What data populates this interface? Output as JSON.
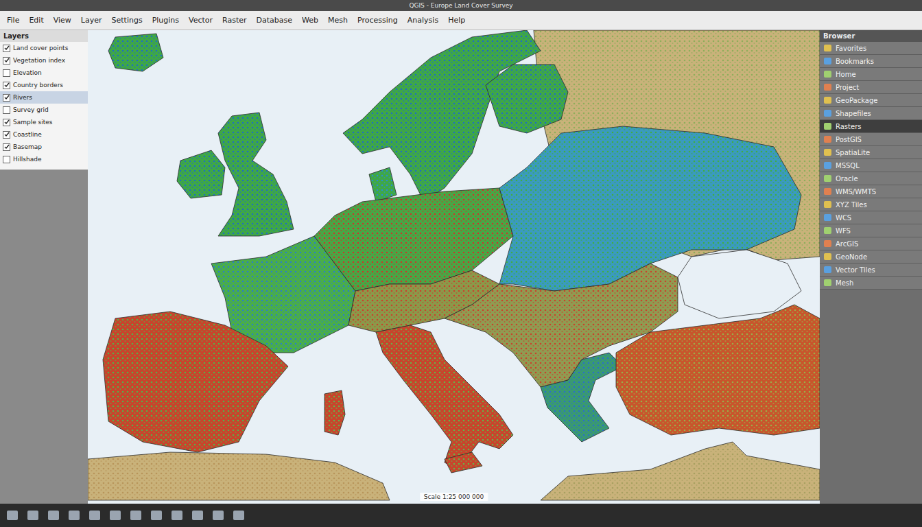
{
  "window": {
    "title": "QGIS - Europe Land Cover Survey"
  },
  "menu": [
    "File",
    "Edit",
    "View",
    "Layer",
    "Settings",
    "Plugins",
    "Vector",
    "Raster",
    "Database",
    "Web",
    "Mesh",
    "Processing",
    "Analysis",
    "Help"
  ],
  "layers": {
    "title": "Layers",
    "items": [
      {
        "label": "Land cover points",
        "checked": true,
        "selected": false
      },
      {
        "label": "Vegetation index",
        "checked": true,
        "selected": false
      },
      {
        "label": "Elevation",
        "checked": false,
        "selected": false
      },
      {
        "label": "Country borders",
        "checked": true,
        "selected": false
      },
      {
        "label": "Rivers",
        "checked": true,
        "selected": true
      },
      {
        "label": "Survey grid",
        "checked": false,
        "selected": false
      },
      {
        "label": "Sample sites",
        "checked": true,
        "selected": false
      },
      {
        "label": "Coastline",
        "checked": true,
        "selected": false
      },
      {
        "label": "Basemap",
        "checked": true,
        "selected": false
      },
      {
        "label": "Hillshade",
        "checked": false,
        "selected": false
      }
    ]
  },
  "browser": {
    "title": "Browser",
    "items": [
      {
        "label": "Favorites",
        "selected": false
      },
      {
        "label": "Bookmarks",
        "selected": false
      },
      {
        "label": "Home",
        "selected": false
      },
      {
        "label": "Project",
        "selected": false
      },
      {
        "label": "GeoPackage",
        "selected": false
      },
      {
        "label": "Shapefiles",
        "selected": false
      },
      {
        "label": "Rasters",
        "selected": true
      },
      {
        "label": "PostGIS",
        "selected": false
      },
      {
        "label": "SpatiaLite",
        "selected": false
      },
      {
        "label": "MSSQL",
        "selected": false
      },
      {
        "label": "Oracle",
        "selected": false
      },
      {
        "label": "WMS/WMTS",
        "selected": false
      },
      {
        "label": "XYZ Tiles",
        "selected": false
      },
      {
        "label": "WCS",
        "selected": false
      },
      {
        "label": "WFS",
        "selected": false
      },
      {
        "label": "ArcGIS",
        "selected": false
      },
      {
        "label": "GeoNode",
        "selected": false
      },
      {
        "label": "Vector Tiles",
        "selected": false
      },
      {
        "label": "Mesh",
        "selected": false
      }
    ]
  },
  "map": {
    "status": "Scale 1:25 000 000",
    "regions": [
      {
        "color": "#c9b27a",
        "accent": "#8fae5a"
      },
      {
        "color": "#c9b27a",
        "accent": "#b8955a"
      },
      {
        "color": "#c9b27a",
        "accent": "#a8a060"
      },
      {
        "color": "#3fa845",
        "accent": "#1f6fc0"
      },
      {
        "color": "#3fa845",
        "accent": "#1f6fc0"
      },
      {
        "color": "#3fa845",
        "accent": "#1f6fc0"
      },
      {
        "color": "#3fa845",
        "accent": "#1f6fc0"
      },
      {
        "color": "#3fa845",
        "accent": "#1f6fc0"
      },
      {
        "color": "#3fa845",
        "accent": "#2a8fd0"
      },
      {
        "color": "#4aae48",
        "accent": "#2a7fc8"
      },
      {
        "color": "#46a846",
        "accent": "#c83a2a"
      },
      {
        "color": "#3a9ac0",
        "accent": "#3fae45"
      },
      {
        "color": "#c8442c",
        "accent": "#5aae48"
      },
      {
        "color": "#8a9a4a",
        "accent": "#c8442c"
      },
      {
        "color": "#c8442c",
        "accent": "#6ab048"
      },
      {
        "color": "#c8442c",
        "accent": "#6ab048"
      },
      {
        "color": "#8f9c52",
        "accent": "#c8442c"
      },
      {
        "color": "#3a9a70",
        "accent": "#2a6fc8"
      },
      {
        "color": "#c8552c",
        "accent": "#9aae48"
      }
    ]
  }
}
